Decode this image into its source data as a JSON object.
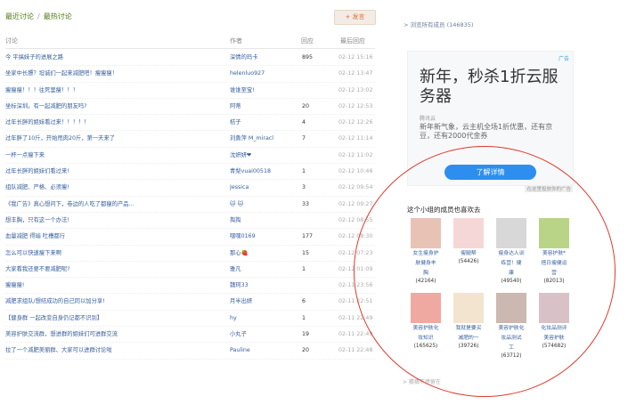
{
  "tabs": {
    "recent": "最近讨论",
    "sep": "/",
    "hot": "最热讨论"
  },
  "post_button": "+ 发言",
  "table": {
    "headers": {
      "title": "讨论",
      "author": "作者",
      "reply": "回应",
      "time": "最后回应"
    },
    "rows": [
      {
        "title": "今 平搞妹子的进展之路",
        "author": "深情的玛卡",
        "reply": "895",
        "time": "02-12 15:16"
      },
      {
        "title": "坐家中长膘？坦诚们一起来减肥吧！瘦瘦瘦！",
        "author": "helenluo927",
        "reply": "",
        "time": "02-12 13:47"
      },
      {
        "title": "瘦瘦瘦！！！往死里瘦！！！",
        "author": "谁谁至宝!",
        "reply": "",
        "time": "02-12 13:02"
      },
      {
        "title": "坐标深圳。有一起减肥的朋友吗?",
        "author": "阿蒂",
        "reply": "20",
        "time": "02-12 12:53"
      },
      {
        "title": "过年长胖的姐妹看过来！！！！！",
        "author": "桔子",
        "reply": "4",
        "time": "02-12 12:26"
      },
      {
        "title": "过年胖了10斤，开始甩肉20斤，第一天来了",
        "author": "刘勇萍 M_miracl",
        "reply": "7",
        "time": "02-12 11:14"
      },
      {
        "title": "一杯一点瘦下来",
        "author": "沈妍妍❤",
        "reply": "",
        "time": "02-12 11:02"
      },
      {
        "title": "过年长胖的姐妹们看过来!",
        "author": "青梨vuai00518",
        "reply": "1",
        "time": "02-12 10:46"
      },
      {
        "title": "组队减肥、严格、必须瘦!",
        "author": "Jessica",
        "reply": "3",
        "time": "02-12 09:54"
      },
      {
        "title": "《我广告》真心想问下，卷边的人吃了都瘦的产品...",
        "author": "🐱 🐱",
        "reply": "33",
        "time": "02-12 09:27"
      },
      {
        "title": "想丰胸，只有这一个办法!",
        "author": "掏掏",
        "reply": "",
        "time": "02-12 08:55"
      },
      {
        "title": "血量减肥 得瑜 吐槽都行",
        "author": "嘿嘿0169",
        "reply": "177",
        "time": "02-12 08:30"
      },
      {
        "title": "怎么可以快速瘦下来啊",
        "author": "那心🍓",
        "reply": "15",
        "time": "02-12 07:23"
      },
      {
        "title": "大家看我还要不要减肥呢?",
        "author": "雅凡",
        "reply": "1",
        "time": "02-12 01:09"
      },
      {
        "title": "瘦瘦瘦!",
        "author": "魏珂33",
        "reply": "",
        "time": "02-11 23:56"
      },
      {
        "title": "减肥求组队/想结成功的自己同以加分享!",
        "author": "月半出妍",
        "reply": "6",
        "time": "02-11 22:51"
      },
      {
        "title": "【健身群 一起改变自身仍记都不识别】",
        "author": "hy",
        "reply": "1",
        "time": "02-11 22:49"
      },
      {
        "title": "美容护肤交流群，想进群的姐妹们可进群交流",
        "author": "小丸子",
        "reply": "19",
        "time": "02-11 22:49"
      },
      {
        "title": "拉了一个减肥美丽群、大家可以进群讨论啦",
        "author": "Pauline",
        "reply": "20",
        "time": "02-11 22:48"
      }
    ]
  },
  "sidebar": {
    "browse_link": "> 浏览所有成员 (146835)",
    "ad": {
      "tag": "广告",
      "headline": "新年，秒杀1折云服务器",
      "brand": "腾讯云",
      "desc": "新年新气象，云主机全场1折优惠，还有京豆，还有2000代金券",
      "cta": "了解详情",
      "footer": "在这里投放你的广告"
    },
    "like_title": "这个小组的成员也喜欢去",
    "groups": [
      {
        "cap1": "女生瘦身护",
        "cap2": "肤健身丰",
        "cap3": "胸",
        "count": "(42164)",
        "color": "#e9c2b6"
      },
      {
        "cap1": "瘦腿帮",
        "cap2": "",
        "cap3": "",
        "count": "(54426)",
        "color": "#f6d7d7"
      },
      {
        "cap1": "瘦身达人训",
        "cap2": "练营！健",
        "cap3": "康",
        "count": "(49540)",
        "color": "#d8d8d8"
      },
      {
        "cap1": "美容护肤*",
        "cap2": "搭日瘦健运",
        "cap3": "营",
        "count": "(82013)",
        "color": "#b9d486"
      },
      {
        "cap1": "美容护肤化",
        "cap2": "妆知识",
        "cap3": "",
        "count": "(165625)",
        "color": "#f0a9a0"
      },
      {
        "cap1": "我就是要买",
        "cap2": "减肥的一",
        "cap3": "",
        "count": "(39726)",
        "color": "#f3e4d0"
      },
      {
        "cap1": "美容护肤化",
        "cap2": "妆品测试",
        "cap3": "工",
        "count": "(63712)",
        "color": "#cbb8b0"
      },
      {
        "cap1": "化妆品测评",
        "cap2": "美容护肤",
        "cap3": "",
        "count": "(574682)",
        "color": "#d8c2c8"
      }
    ],
    "more": "> 猜猜不停留在"
  },
  "colors": {
    "link": "#355f9c",
    "accent_green": "#4a7a12",
    "highlight_circle": "#e03a2a",
    "cta_blue": "#2d8ef0"
  }
}
